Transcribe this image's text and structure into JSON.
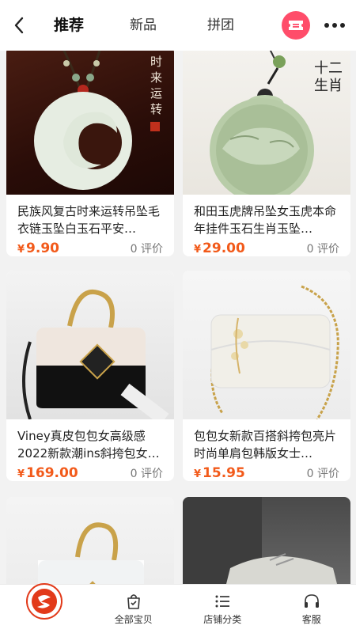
{
  "header": {
    "tabs": [
      {
        "label": "推荐",
        "active": true
      },
      {
        "label": "新品",
        "active": false
      },
      {
        "label": "拼团",
        "active": false
      }
    ]
  },
  "products": [
    {
      "title": "民族风复古时来运转吊坠毛衣链玉坠白玉石平安…",
      "price": "9.90",
      "reviews": "0 评价",
      "image": "jade-crescent-pendant",
      "image_text": "时来运转"
    },
    {
      "title": "和田玉虎牌吊坠女玉虎本命年挂件玉石生肖玉坠…",
      "price": "29.00",
      "reviews": "0 评价",
      "image": "jade-tiger-pendant",
      "image_text": "十二生肖"
    },
    {
      "title": "Viney真皮包包女高级感2022新款潮ins斜挎包女…",
      "price": "169.00",
      "reviews": "0 评价",
      "image": "black-white-handbag",
      "image_text": ""
    },
    {
      "title": "包包女新款百搭斜挎包亮片时尚单肩包韩版女士…",
      "price": "15.95",
      "reviews": "0 评价",
      "image": "white-chain-bag",
      "image_text": ""
    },
    {
      "title": "",
      "price": "",
      "reviews": "",
      "image": "grey-handbag",
      "image_text": ""
    },
    {
      "title": "",
      "price": "",
      "reviews": "",
      "image": "grey-sneaker",
      "image_text": ""
    }
  ],
  "currency": "¥",
  "bottom_nav": [
    {
      "label": "",
      "icon": "shop-logo-icon"
    },
    {
      "label": "全部宝贝",
      "icon": "bag-icon"
    },
    {
      "label": "店铺分类",
      "icon": "list-icon"
    },
    {
      "label": "客服",
      "icon": "headset-icon"
    }
  ],
  "colors": {
    "accent": "#f25a1a",
    "ticket": "#ff4d6a",
    "logo": "#e23a1a"
  }
}
